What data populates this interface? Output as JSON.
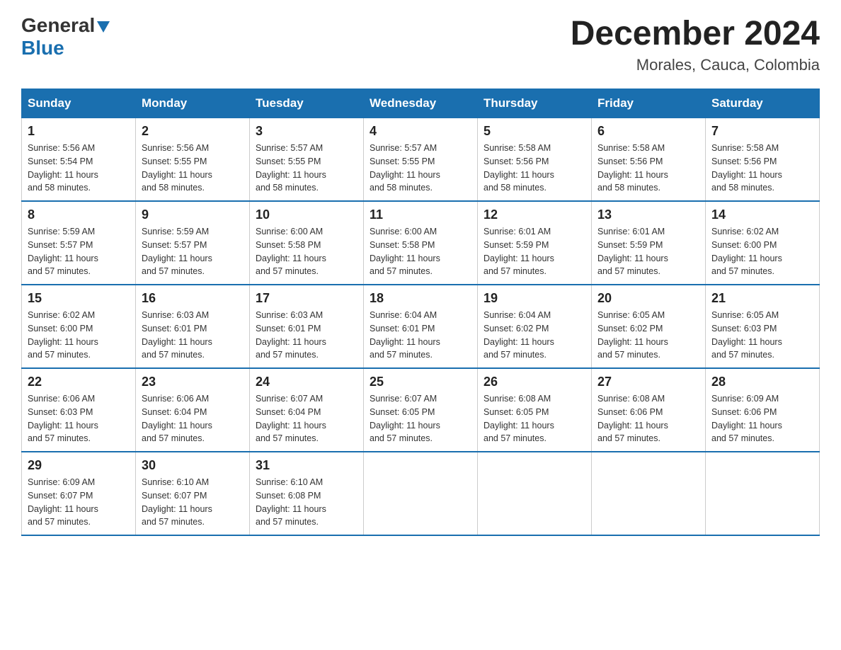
{
  "logo": {
    "text_general": "General",
    "text_blue": "Blue"
  },
  "title": "December 2024",
  "subtitle": "Morales, Cauca, Colombia",
  "days_header": [
    "Sunday",
    "Monday",
    "Tuesday",
    "Wednesday",
    "Thursday",
    "Friday",
    "Saturday"
  ],
  "weeks": [
    [
      {
        "day": "1",
        "sunrise": "5:56 AM",
        "sunset": "5:54 PM",
        "daylight": "11 hours and 58 minutes."
      },
      {
        "day": "2",
        "sunrise": "5:56 AM",
        "sunset": "5:55 PM",
        "daylight": "11 hours and 58 minutes."
      },
      {
        "day": "3",
        "sunrise": "5:57 AM",
        "sunset": "5:55 PM",
        "daylight": "11 hours and 58 minutes."
      },
      {
        "day": "4",
        "sunrise": "5:57 AM",
        "sunset": "5:55 PM",
        "daylight": "11 hours and 58 minutes."
      },
      {
        "day": "5",
        "sunrise": "5:58 AM",
        "sunset": "5:56 PM",
        "daylight": "11 hours and 58 minutes."
      },
      {
        "day": "6",
        "sunrise": "5:58 AM",
        "sunset": "5:56 PM",
        "daylight": "11 hours and 58 minutes."
      },
      {
        "day": "7",
        "sunrise": "5:58 AM",
        "sunset": "5:56 PM",
        "daylight": "11 hours and 58 minutes."
      }
    ],
    [
      {
        "day": "8",
        "sunrise": "5:59 AM",
        "sunset": "5:57 PM",
        "daylight": "11 hours and 57 minutes."
      },
      {
        "day": "9",
        "sunrise": "5:59 AM",
        "sunset": "5:57 PM",
        "daylight": "11 hours and 57 minutes."
      },
      {
        "day": "10",
        "sunrise": "6:00 AM",
        "sunset": "5:58 PM",
        "daylight": "11 hours and 57 minutes."
      },
      {
        "day": "11",
        "sunrise": "6:00 AM",
        "sunset": "5:58 PM",
        "daylight": "11 hours and 57 minutes."
      },
      {
        "day": "12",
        "sunrise": "6:01 AM",
        "sunset": "5:59 PM",
        "daylight": "11 hours and 57 minutes."
      },
      {
        "day": "13",
        "sunrise": "6:01 AM",
        "sunset": "5:59 PM",
        "daylight": "11 hours and 57 minutes."
      },
      {
        "day": "14",
        "sunrise": "6:02 AM",
        "sunset": "6:00 PM",
        "daylight": "11 hours and 57 minutes."
      }
    ],
    [
      {
        "day": "15",
        "sunrise": "6:02 AM",
        "sunset": "6:00 PM",
        "daylight": "11 hours and 57 minutes."
      },
      {
        "day": "16",
        "sunrise": "6:03 AM",
        "sunset": "6:01 PM",
        "daylight": "11 hours and 57 minutes."
      },
      {
        "day": "17",
        "sunrise": "6:03 AM",
        "sunset": "6:01 PM",
        "daylight": "11 hours and 57 minutes."
      },
      {
        "day": "18",
        "sunrise": "6:04 AM",
        "sunset": "6:01 PM",
        "daylight": "11 hours and 57 minutes."
      },
      {
        "day": "19",
        "sunrise": "6:04 AM",
        "sunset": "6:02 PM",
        "daylight": "11 hours and 57 minutes."
      },
      {
        "day": "20",
        "sunrise": "6:05 AM",
        "sunset": "6:02 PM",
        "daylight": "11 hours and 57 minutes."
      },
      {
        "day": "21",
        "sunrise": "6:05 AM",
        "sunset": "6:03 PM",
        "daylight": "11 hours and 57 minutes."
      }
    ],
    [
      {
        "day": "22",
        "sunrise": "6:06 AM",
        "sunset": "6:03 PM",
        "daylight": "11 hours and 57 minutes."
      },
      {
        "day": "23",
        "sunrise": "6:06 AM",
        "sunset": "6:04 PM",
        "daylight": "11 hours and 57 minutes."
      },
      {
        "day": "24",
        "sunrise": "6:07 AM",
        "sunset": "6:04 PM",
        "daylight": "11 hours and 57 minutes."
      },
      {
        "day": "25",
        "sunrise": "6:07 AM",
        "sunset": "6:05 PM",
        "daylight": "11 hours and 57 minutes."
      },
      {
        "day": "26",
        "sunrise": "6:08 AM",
        "sunset": "6:05 PM",
        "daylight": "11 hours and 57 minutes."
      },
      {
        "day": "27",
        "sunrise": "6:08 AM",
        "sunset": "6:06 PM",
        "daylight": "11 hours and 57 minutes."
      },
      {
        "day": "28",
        "sunrise": "6:09 AM",
        "sunset": "6:06 PM",
        "daylight": "11 hours and 57 minutes."
      }
    ],
    [
      {
        "day": "29",
        "sunrise": "6:09 AM",
        "sunset": "6:07 PM",
        "daylight": "11 hours and 57 minutes."
      },
      {
        "day": "30",
        "sunrise": "6:10 AM",
        "sunset": "6:07 PM",
        "daylight": "11 hours and 57 minutes."
      },
      {
        "day": "31",
        "sunrise": "6:10 AM",
        "sunset": "6:08 PM",
        "daylight": "11 hours and 57 minutes."
      },
      null,
      null,
      null,
      null
    ]
  ],
  "labels": {
    "sunrise": "Sunrise:",
    "sunset": "Sunset:",
    "daylight": "Daylight:"
  }
}
